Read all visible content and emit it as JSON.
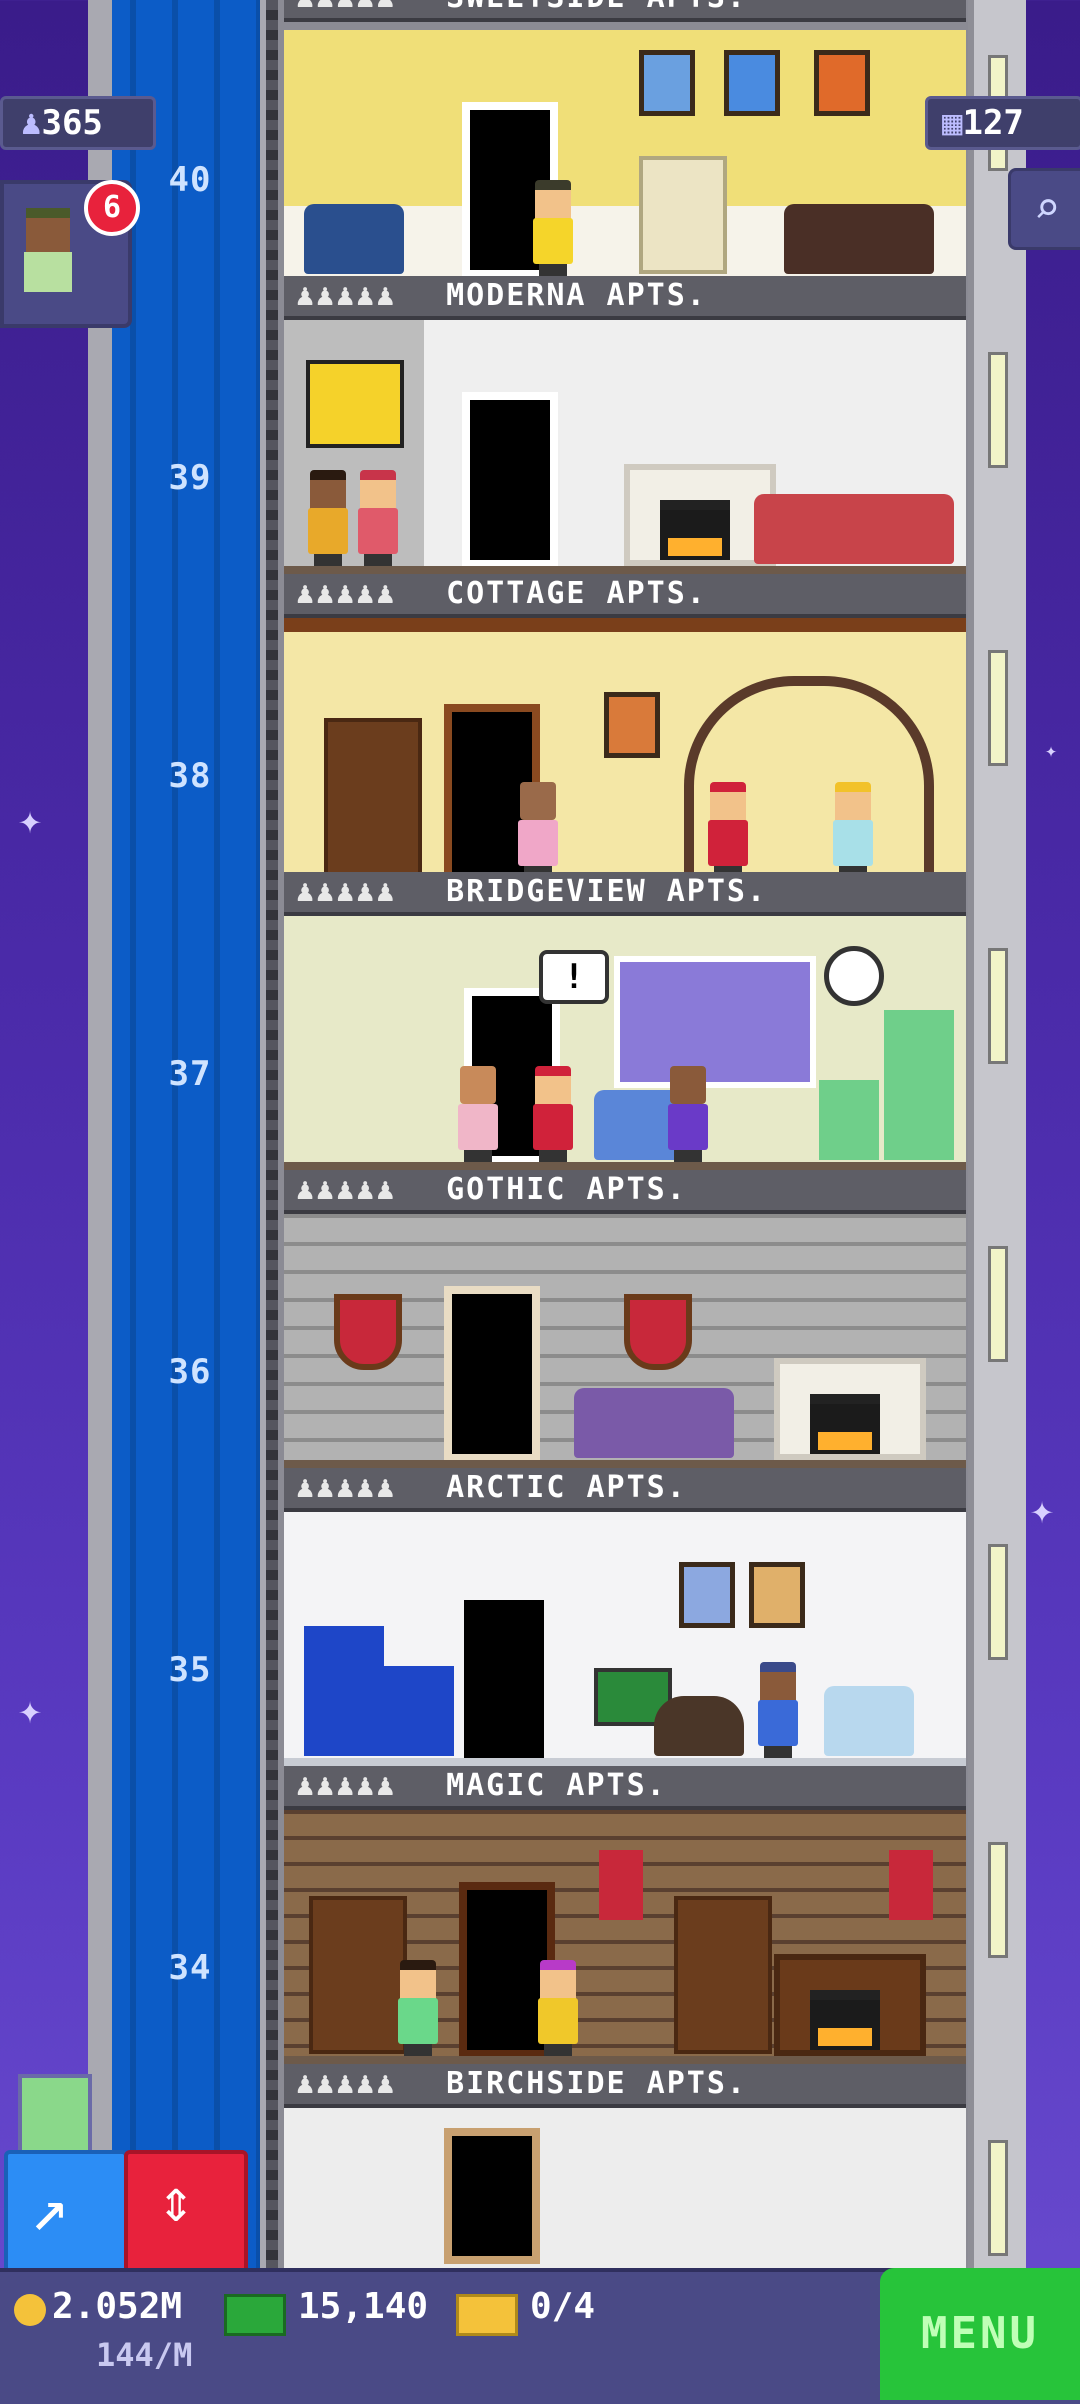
{
  "header_top_label": "SWEETSIDE APTS.",
  "hud": {
    "population": "365",
    "floors_count": "127",
    "notification_badge": "6"
  },
  "floors": [
    {
      "number": "40",
      "name": "SWEETSIDE APTS."
    },
    {
      "number": "39",
      "name": "MODERNA APTS."
    },
    {
      "number": "38",
      "name": "COTTAGE APTS."
    },
    {
      "number": "37",
      "name": "BRIDGEVIEW APTS."
    },
    {
      "number": "36",
      "name": "GOTHIC APTS."
    },
    {
      "number": "35",
      "name": "ARCTIC APTS."
    },
    {
      "number": "34",
      "name": "MAGIC APTS."
    },
    {
      "number": "",
      "name": "BIRCHSIDE APTS."
    }
  ],
  "bubble_text": "!",
  "bottom_bar": {
    "coins": "2.052M",
    "coin_rate": "144/M",
    "bux": "15,140",
    "tickets": "0/4",
    "menu_label": "MENU"
  },
  "colors": {
    "elevator_blue": "#0c5cc7",
    "menu_green": "#27c43a",
    "elevator_button_red": "#e8223c",
    "move_button_blue": "#2c8df5"
  },
  "icons": [
    "population-icon",
    "floors-grid-icon",
    "search-icon",
    "coin-icon",
    "bux-icon",
    "ticket-icon",
    "elevator-arrow-icon",
    "move-arrow-icon"
  ]
}
